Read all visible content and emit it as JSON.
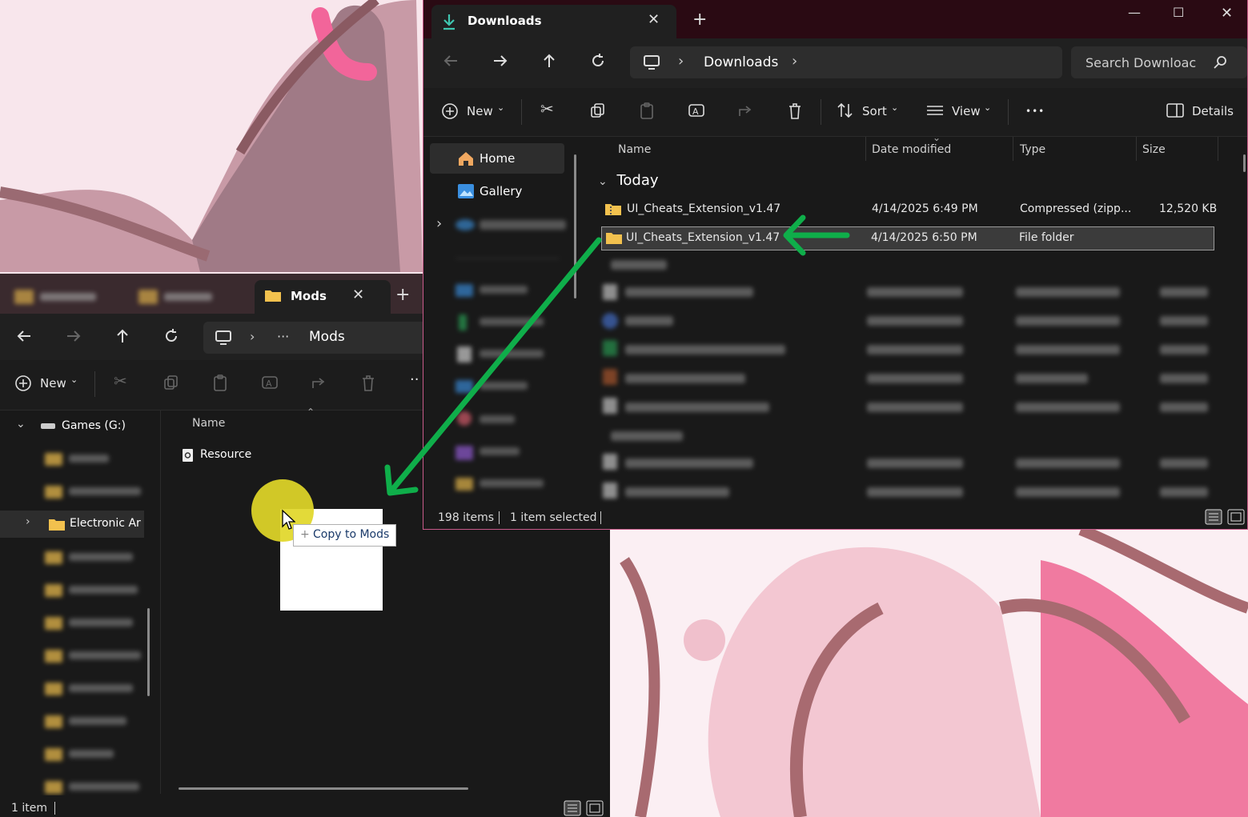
{
  "downloads_window": {
    "tab_title": "Downloads",
    "breadcrumb": [
      "Downloads"
    ],
    "search_placeholder": "Search Downloac",
    "toolbar": {
      "new_label": "New",
      "sort_label": "Sort",
      "view_label": "View",
      "more_label": "•••",
      "details_label": "Details"
    },
    "nav": {
      "home": "Home",
      "gallery": "Gallery"
    },
    "columns": {
      "name": "Name",
      "date_modified": "Date modified",
      "type": "Type",
      "size": "Size"
    },
    "groups": {
      "today": "Today"
    },
    "files": [
      {
        "name": "UI_Cheats_Extension_v1.47",
        "date": "4/14/2025 6:49 PM",
        "type": "Compressed (zipp...",
        "size": "12,520 KB",
        "icon": "zip-folder-icon"
      },
      {
        "name": "UI_Cheats_Extension_v1.47",
        "date": "4/14/2025 6:50 PM",
        "type": "File folder",
        "size": "",
        "icon": "folder-icon"
      }
    ],
    "status": {
      "item_count": "198 items",
      "selected": "1 item selected"
    }
  },
  "mods_window": {
    "tab_title": "Mods",
    "breadcrumb": [
      "···",
      "Mods"
    ],
    "toolbar": {
      "new_label": "New"
    },
    "tree": {
      "drive": "Games (G:)",
      "selected_folder": "Electronic Ar"
    },
    "columns": {
      "name": "Name"
    },
    "files": [
      {
        "name": "Resource",
        "icon": "settings-file-icon"
      }
    ],
    "status": {
      "item_count": "1 item"
    }
  },
  "drag": {
    "tooltip": "Copy to Mods",
    "tooltip_prefix": "+"
  },
  "colors": {
    "accent_green": "#0fae4a",
    "explorer_bg": "#191919",
    "cursor_highlight": "#e1d728",
    "folder_yellow": "#f2c14e"
  }
}
